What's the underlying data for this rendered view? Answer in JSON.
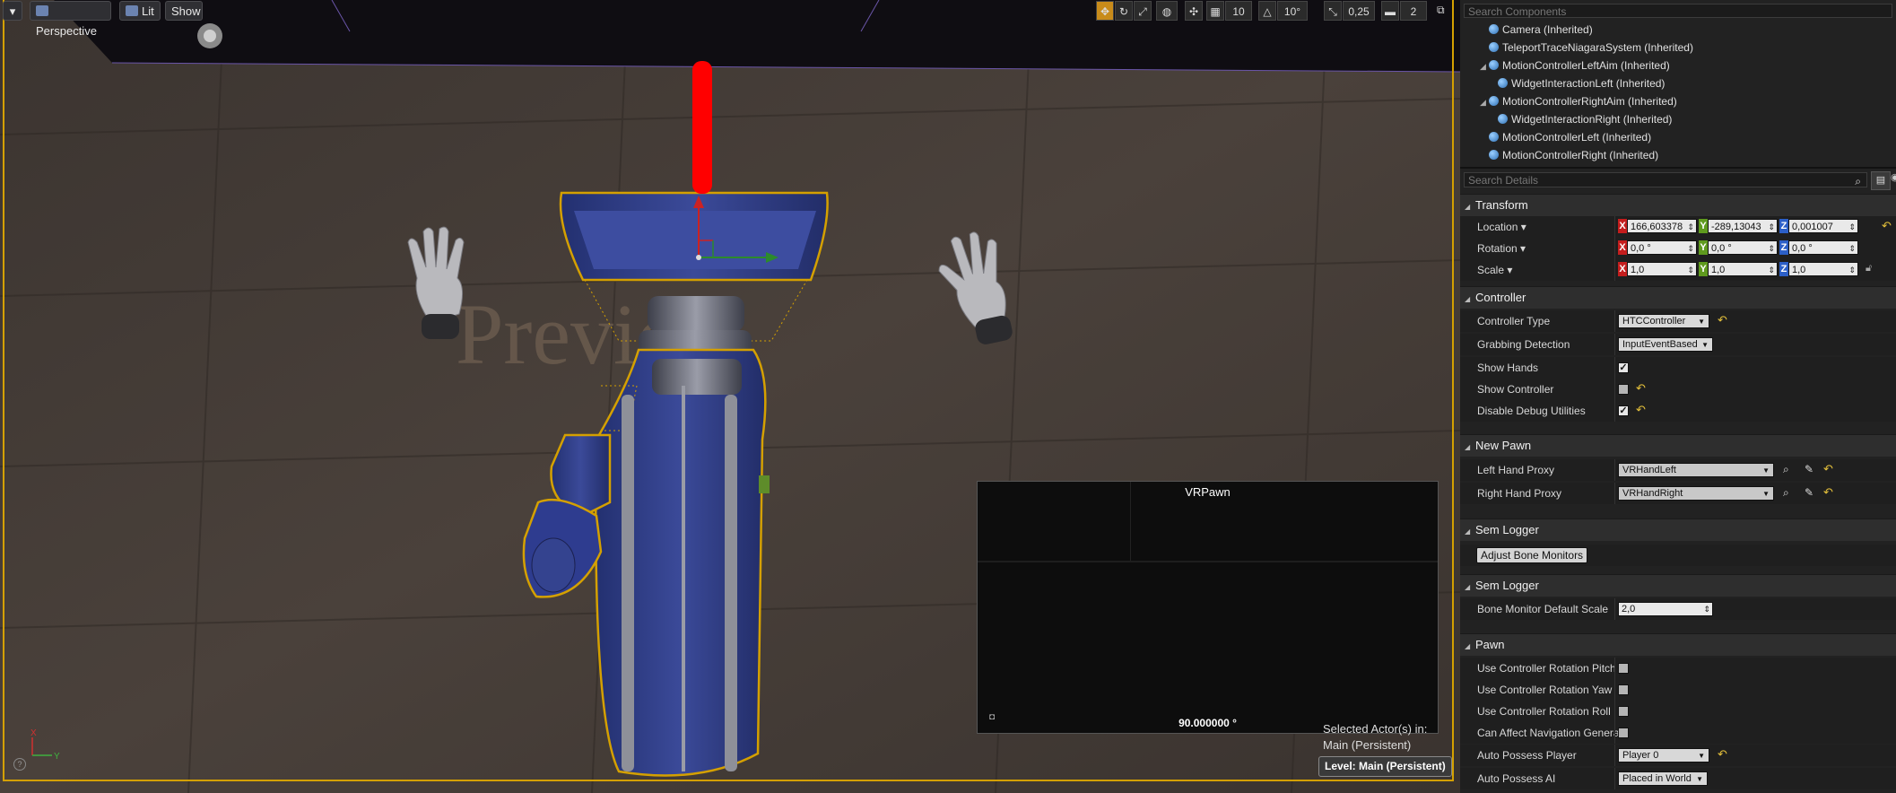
{
  "viewport": {
    "menu_caret": "▾",
    "perspective_label": "Perspective",
    "lit_label": "Lit",
    "show_label": "Show",
    "grid_value": "10",
    "rot_value": "10°",
    "scale_value": "0,25",
    "cam_speed": "2",
    "watermark": "Preview",
    "pip": {
      "title": "VRPawn",
      "angle": "90.000000 °"
    },
    "selected_line1": "Selected Actor(s) in:",
    "selected_line2": "Main (Persistent)",
    "level_label": "Level:  Main (Persistent)",
    "axis_x": "X",
    "axis_y": "Y",
    "help": "?",
    "selection_color": "#d4a000"
  },
  "components": {
    "search_placeholder": "Search Components",
    "items": [
      {
        "label": "Camera (Inherited)",
        "indent": 0,
        "expander": ""
      },
      {
        "label": "TeleportTraceNiagaraSystem (Inherited)",
        "indent": 0,
        "expander": ""
      },
      {
        "label": "MotionControllerLeftAim (Inherited)",
        "indent": 0,
        "expander": "◢"
      },
      {
        "label": "WidgetInteractionLeft (Inherited)",
        "indent": 1,
        "expander": ""
      },
      {
        "label": "MotionControllerRightAim (Inherited)",
        "indent": 0,
        "expander": "◢"
      },
      {
        "label": "WidgetInteractionRight (Inherited)",
        "indent": 1,
        "expander": ""
      },
      {
        "label": "MotionControllerLeft (Inherited)",
        "indent": 0,
        "expander": ""
      },
      {
        "label": "MotionControllerRight (Inherited)",
        "indent": 0,
        "expander": ""
      }
    ]
  },
  "details": {
    "search_placeholder": "Search Details",
    "transform": {
      "title": "Transform",
      "location_label": "Location ▾",
      "rotation_label": "Rotation ▾",
      "scale_label": "Scale ▾",
      "location": {
        "x": "166,603378",
        "y": "-289,13043",
        "z": "0,001007"
      },
      "rotation": {
        "x": "0,0 °",
        "y": "0,0 °",
        "z": "0,0 °"
      },
      "scale": {
        "x": "1,0",
        "y": "1,0",
        "z": "1,0"
      }
    },
    "controller": {
      "title": "Controller",
      "controller_type_label": "Controller Type",
      "controller_type_value": "HTCController",
      "grabbing_label": "Grabbing Detection",
      "grabbing_value": "InputEventBased",
      "show_hands_label": "Show Hands",
      "show_hands": true,
      "show_controller_label": "Show Controller",
      "show_controller": false,
      "disable_debug_label": "Disable Debug Utilities",
      "disable_debug": true
    },
    "new_pawn": {
      "title": "New Pawn",
      "left_label": "Left Hand Proxy",
      "left_value": "VRHandLeft",
      "right_label": "Right Hand Proxy",
      "right_value": "VRHandRight"
    },
    "sem_logger_1": {
      "title": "Sem Logger",
      "button": "Adjust Bone Monitors"
    },
    "sem_logger_2": {
      "title": "Sem Logger",
      "bone_scale_label": "Bone Monitor Default Scale",
      "bone_scale_value": "2,0"
    },
    "pawn": {
      "title": "Pawn",
      "pitch_label": "Use Controller Rotation Pitch",
      "yaw_label": "Use Controller Rotation Yaw",
      "roll_label": "Use Controller Rotation Roll",
      "nav_label": "Can Affect Navigation Generat",
      "auto_player_label": "Auto Possess Player",
      "auto_player_value": "Player 0",
      "auto_ai_label": "Auto Possess AI",
      "auto_ai_value": "Placed in World"
    }
  }
}
